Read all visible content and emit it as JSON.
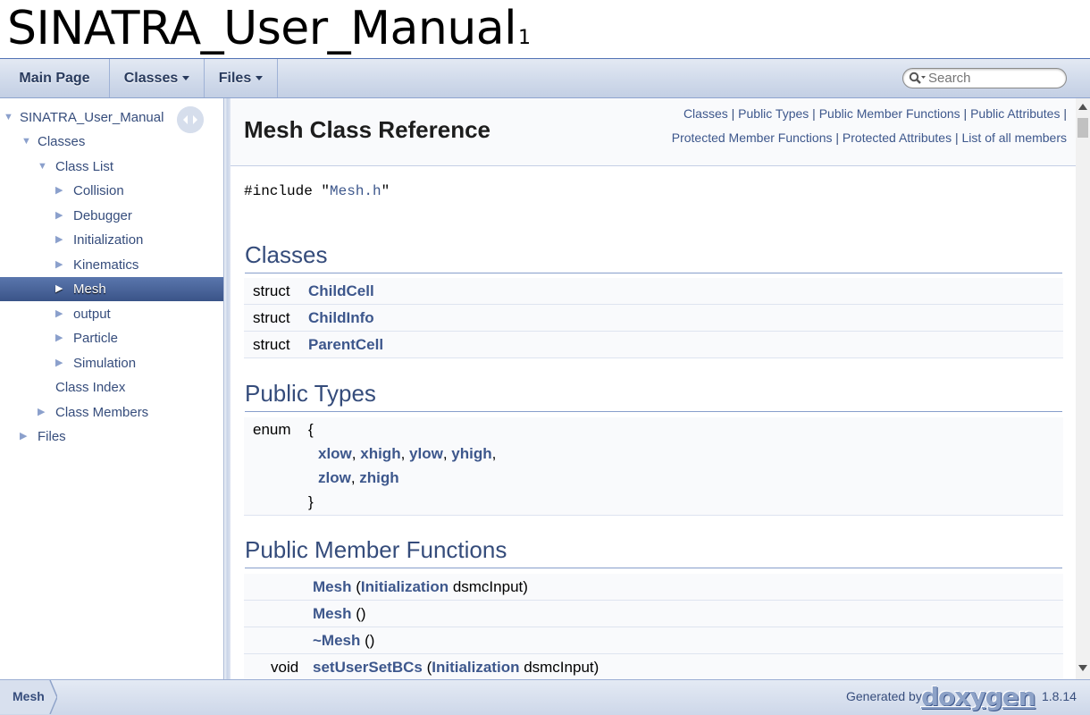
{
  "project": {
    "name": "SINATRA_User_Manual",
    "number": "1"
  },
  "navbar": {
    "main_page": "Main Page",
    "classes": "Classes",
    "files": "Files",
    "search_placeholder": "Search"
  },
  "sidenav": {
    "root": "SINATRA_User_Manual",
    "classes": "Classes",
    "class_list": "Class List",
    "items": [
      "Collision",
      "Debugger",
      "Initialization",
      "Kinematics",
      "Mesh",
      "output",
      "Particle",
      "Simulation"
    ],
    "class_index": "Class Index",
    "class_members": "Class Members",
    "files": "Files"
  },
  "header": {
    "title": "Mesh Class Reference",
    "links": [
      "Classes",
      "Public Types",
      "Public Member Functions",
      "Public Attributes",
      "Protected Member Functions",
      "Protected Attributes",
      "List of all members"
    ]
  },
  "include": {
    "prefix": "#include \"",
    "file": "Mesh.h",
    "suffix": "\""
  },
  "sections": {
    "classes": "Classes",
    "public_types": "Public Types",
    "public_member_functions": "Public Member Functions"
  },
  "classes": [
    {
      "type": "struct",
      "name": "ChildCell"
    },
    {
      "type": "struct",
      "name": "ChildInfo"
    },
    {
      "type": "struct",
      "name": "ParentCell"
    }
  ],
  "enum": {
    "type": "enum",
    "open": "{",
    "values": [
      "xlow",
      "xhigh",
      "ylow",
      "yhigh",
      "zlow",
      "zhigh"
    ],
    "close": "}"
  },
  "functions": [
    {
      "ret": "",
      "name": "Mesh",
      "open": " (",
      "ptype": "Initialization",
      "pname": " dsmcInput)"
    },
    {
      "ret": "",
      "name": "Mesh",
      "open": " ()",
      "ptype": "",
      "pname": ""
    },
    {
      "ret": "",
      "name": "~Mesh",
      "open": " ()",
      "ptype": "",
      "pname": ""
    },
    {
      "ret": "void",
      "name": "setUserSetBCs",
      "open": " (",
      "ptype": "Initialization",
      "pname": " dsmcInput)"
    }
  ],
  "footer": {
    "crumb": "Mesh",
    "generated_by": "Generated by",
    "logo_text": "doxygen",
    "version": "1.8.14"
  },
  "colors": {
    "link": "#3d578c",
    "nav_text": "#283a5d",
    "selected_bg": "#3a5488"
  }
}
